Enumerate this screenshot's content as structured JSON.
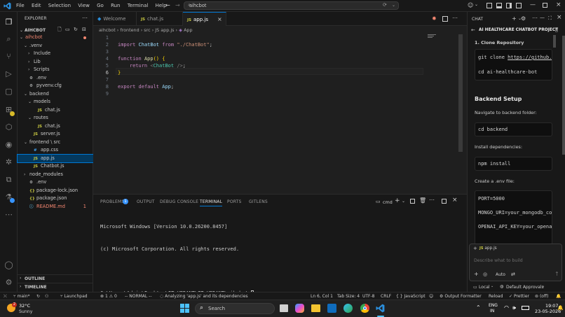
{
  "titlebar": {
    "menu": [
      "File",
      "Edit",
      "Selection",
      "View",
      "Go",
      "Run",
      "Terminal",
      "Help"
    ],
    "search_text": "aihcbot"
  },
  "explorer": {
    "header": "EXPLORER",
    "root": "AIHCBOT",
    "items": [
      {
        "label": "aihcbot",
        "kind": "folder",
        "depth": 0,
        "color": "#f48771"
      },
      {
        "label": ".venv",
        "kind": "folder",
        "depth": 1
      },
      {
        "label": "Include",
        "kind": "folder",
        "depth": 2,
        "collapsed": true
      },
      {
        "label": "Lib",
        "kind": "folder",
        "depth": 2,
        "collapsed": true
      },
      {
        "label": "Scripts",
        "kind": "folder",
        "depth": 2,
        "collapsed": true
      },
      {
        "label": ".env",
        "kind": "env",
        "depth": 1
      },
      {
        "label": "pyvenv.cfg",
        "kind": "cfg",
        "depth": 1
      },
      {
        "label": "backend",
        "kind": "folder",
        "depth": 1
      },
      {
        "label": "models",
        "kind": "folder",
        "depth": 2
      },
      {
        "label": "chat.js",
        "kind": "js",
        "depth": 3
      },
      {
        "label": "routes",
        "kind": "folder",
        "depth": 2
      },
      {
        "label": "chat.js",
        "kind": "js",
        "depth": 3
      },
      {
        "label": "server.js",
        "kind": "js",
        "depth": 2
      },
      {
        "label": "frontend \\ src",
        "kind": "folder",
        "depth": 1
      },
      {
        "label": "app.css",
        "kind": "css",
        "depth": 2
      },
      {
        "label": "app.js",
        "kind": "js",
        "depth": 2,
        "selected": true
      },
      {
        "label": "Chatbot.js",
        "kind": "js",
        "depth": 2
      },
      {
        "label": "node_modules",
        "kind": "folder",
        "depth": 1,
        "collapsed": true
      },
      {
        "label": ".env",
        "kind": "env",
        "depth": 1
      },
      {
        "label": "package-lock.json",
        "kind": "json",
        "depth": 1
      },
      {
        "label": "package.json",
        "kind": "json",
        "depth": 1
      },
      {
        "label": "README.md",
        "kind": "info",
        "depth": 1,
        "color": "#f48771",
        "badge": "1"
      }
    ],
    "outline": "OUTLINE",
    "timeline": "TIMELINE"
  },
  "tabs": [
    {
      "label": "Welcome",
      "icon": "vscode"
    },
    {
      "label": "chat.js",
      "icon": "JS"
    },
    {
      "label": "app.js",
      "icon": "JS",
      "active": true
    }
  ],
  "breadcrumb": [
    "aihcbot",
    "frontend",
    "src",
    "JS app.js",
    "App"
  ],
  "editor": {
    "lines": [
      {
        "n": "1",
        "html": ""
      },
      {
        "n": "2",
        "html": "<span class='kw'>import</span> <span class='vr'>ChatBot</span> <span class='kw'>from</span> <span class='str'>\"./ChatBot\"</span>;"
      },
      {
        "n": "3",
        "html": ""
      },
      {
        "n": "4",
        "html": "<span class='kw'>function</span> <span class='fn'>App</span><span class='br'>()</span> <span class='br'>{</span>"
      },
      {
        "n": "5",
        "html": "    <span class='kw'>return</span> <span class='punc'>&lt;</span><span class='tag'>ChatBot</span> <span class='punc'>/&gt;</span>;"
      },
      {
        "n": "6",
        "html": "<span class='br'>}</span>"
      },
      {
        "n": "7",
        "html": ""
      },
      {
        "n": "8",
        "html": "<span class='kw'>export</span> <span class='kw'>default</span> <span class='vr'>App</span>;"
      },
      {
        "n": "9",
        "html": ""
      }
    ]
  },
  "panel": {
    "tabs": [
      "PROBLEMS",
      "OUTPUT",
      "DEBUG CONSOLE",
      "TERMINAL",
      "PORTS",
      "GITLENS"
    ],
    "problems_badge": "1",
    "active_tab": "TERMINAL",
    "terminal_name": "cmd",
    "terminal_lines": [
      "Microsoft Windows [Version 10.0.26200.8457]",
      "(c) Microsoft Corporation. All rights reserved.",
      "",
      "C:\\Users\\Admin\\Desktop\\IT VEDANT\\IT VEDANT\\aihcbot>"
    ]
  },
  "chat": {
    "header": "CHAT",
    "title": "AI HEALTHCARE CHATBOT PROJECT",
    "step1": "1. Clone Repository",
    "code_clone_cmd": "git clone",
    "code_clone_url": "https://github.c",
    "code_cd": "cd ai-healthcare-bot",
    "backend_heading": "Backend Setup",
    "nav_backend": "Navigate to backend folder:",
    "code_cd_backend": "cd backend",
    "install_deps": "Install dependencies:",
    "code_npm": "npm install",
    "create_env": "Create a .env file:",
    "env_port": "PORT=5000",
    "env_mongo": "MONGO_URI=your_mongodb_con",
    "env_openai": "OPENAI_API_KEY=your_openai",
    "context_file": "app.js",
    "input_placeholder": "Describe what to build",
    "mode": "Auto",
    "footer_local": "Local",
    "footer_approvals": "Default Approvals"
  },
  "statusbar": {
    "branch": "main*",
    "errors": "1",
    "warnings": "0",
    "launchpad": "Launchpad",
    "mode": "-- NORMAL --",
    "analyzing": "Analyzing 'app.js' and its dependencies",
    "position": "Ln 6, Col 1",
    "tab_size": "Tab Size: 4",
    "encoding": "UTF-8",
    "eol": "CRLF",
    "language": "JavaScript",
    "output_formatter": "Output Formatter",
    "reload": "Reload",
    "prettier": "Prettier",
    "off": "(off)"
  },
  "taskbar": {
    "weather_temp": "32°C",
    "weather_desc": "Sunny",
    "weather_badge": "2",
    "search": "Search",
    "lang_top": "ENG",
    "lang_bottom": "IN",
    "time": "19:07",
    "date": "23-05-2026"
  }
}
